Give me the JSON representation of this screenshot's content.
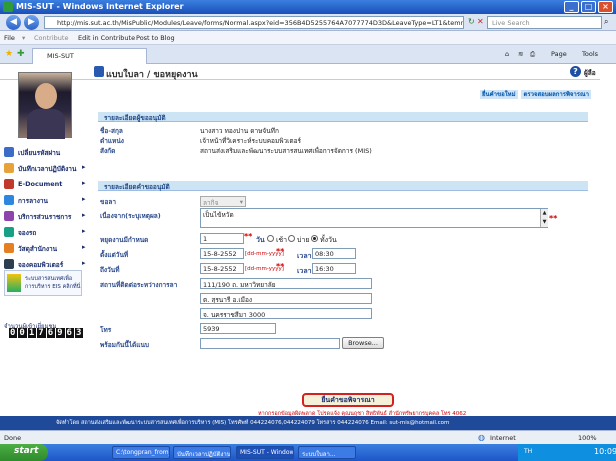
{
  "window": {
    "title": "MIS-SUT - Windows Internet Explorer"
  },
  "browser": {
    "url": "http://mis.sut.ac.th/MisPublic/Modules/Leave/forms/Normal.aspx?eid=356B4D5255764A7077774D3D&LeaveType=LT1&temno=",
    "search_placeholder": "Live Search",
    "menu": {
      "file": "File",
      "contribute": "Contribute",
      "edit_in_contribute": "Edit in Contribute",
      "post_to_blog": "Post to Blog"
    },
    "tab_label": "MIS-SUT",
    "tools": {
      "page": "Page",
      "tools": "Tools"
    }
  },
  "header": {
    "title": "แบบใบลา / ขอหยุดงาน",
    "user": "ผู้ลือ"
  },
  "top_links": [
    "ยื่นคำขอใหม่",
    "ตรวจสอบผลการพิจารณา"
  ],
  "sidebar": {
    "items": [
      {
        "label": "เปลี่ยนรหัสผ่าน",
        "color": "#3b6cc6"
      },
      {
        "label": "บันทึกเวลาปฏิบัติงาน",
        "color": "#e8a23a"
      },
      {
        "label": "E-Document",
        "color": "#c0392b"
      },
      {
        "label": "การลางาน",
        "color": "#2e86de"
      },
      {
        "label": "บริการส่วนราชการ",
        "color": "#8e44ad"
      },
      {
        "label": "จองรถ",
        "color": "#16a085"
      },
      {
        "label": "วัสดุสำนักงาน",
        "color": "#e67e22"
      },
      {
        "label": "จองคอมพิวเตอร์",
        "color": "#2c3e50"
      }
    ],
    "eis_label": "ระบบสารสนเทศเพื่อการบริหาร EIS คลิกที่นี่",
    "counter_label": "จำนวนผู้เข้าเยี่ยมชม",
    "counter_digits": [
      "0",
      "0",
      "1",
      "7",
      "6",
      "9",
      "6",
      "3"
    ]
  },
  "approver_section": {
    "title": "รายละเอียดผู้ขออนุมัติ",
    "rows": [
      {
        "label": "ชื่อ-สกุล",
        "value": "นางสาว ทองปาน ดาษจันทึก"
      },
      {
        "label": "ตำแหน่ง",
        "value": "เจ้าหน้าที่วิเคราะห์ระบบคอมพิวเตอร์"
      },
      {
        "label": "สังกัด",
        "value": "สถานส่งเสริมและพัฒนาระบบสารสนเทศเพื่อการจัดการ (MIS)"
      }
    ]
  },
  "request_section": {
    "title": "รายละเอียดคำขออนุมัติ",
    "leave_type_label": "ขอลา",
    "leave_type_value": "ลากิจ",
    "reason_label": "เนื่องจาก(ระบุเหตุผล)",
    "reason_value": "เป็นไข้หวัด",
    "days_label": "หยุดงานมีกำหนด",
    "days_value": "1",
    "days_unit": "วัน",
    "radio_morning": "เช้า",
    "radio_afternoon": "บ่าย",
    "radio_fullday": "ทั้งวัน",
    "start_label": "ตั้งแต่วันที่",
    "start_date": "15-8-2552",
    "date_hint": "[dd-mm-yyyy]",
    "time_label": "เวลา",
    "start_time": "08:30",
    "end_label": "ถึงวันที่",
    "end_date": "15-8-2552",
    "end_time": "16:30",
    "address_label": "สถานที่ติดต่อระหว่างการลา",
    "address_line1": "111/190 ถ. มหาวิทยาลัย",
    "address_line2": "ต. สุรนารี อ.เมือง",
    "address_line3": "จ. นครราชสีมา 3000",
    "phone_label": "โทร",
    "phone_value": "5939",
    "attach_label": "พร้อมกันนี้ได้แนบ",
    "browse_label": "Browse...",
    "submit_label": "ยื่นคำขอพิจารณา",
    "note": "หากกรอกข้อมูลผิดพลาด โปรดแจ้ง คุณนฤชา สิทธิพันธ์ สำนักทรัพยากรบุคคล โทร 4062"
  },
  "footer": {
    "text": "จัดทำโดย สถานส่งเสริมและพัฒนาระบบสารสนเทศเพื่อการบริหาร (MIS) โทรศัพท์ 044224076,044224079 โทรสาร 044224076 Email: sut-mis@hotmail.com"
  },
  "statusbar": {
    "left": "Done",
    "zone": "Internet",
    "zoom": "100%"
  },
  "taskbar": {
    "start": "start",
    "tasks": [
      "C:\\tongpran_from_1...",
      "บันทึกเวลาปฏิบัติงาน...",
      "MIS-SUT - Windows I...",
      "ระบบใบลา..."
    ],
    "tray_lang": "TH",
    "clock": "10:09"
  }
}
